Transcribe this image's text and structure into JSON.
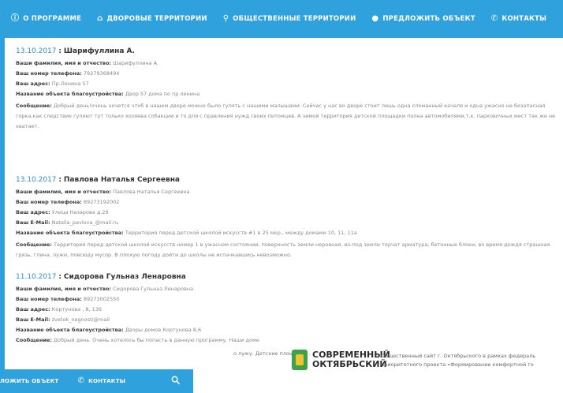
{
  "nav": {
    "items": [
      {
        "icon": "ⓘ",
        "label": "О ПРОГРАММЕ"
      },
      {
        "icon": "⌂",
        "label": "ДВОРОВЫЕ ТЕРРИТОРИИ"
      },
      {
        "icon": "⚲",
        "label": "ОБЩЕСТВЕННЫЕ ТЕРРИТОРИИ"
      },
      {
        "icon": "●",
        "label": "ПРЕДЛОЖИТЬ ОБЪЕКТ"
      },
      {
        "icon": "✆",
        "label": "КОНТАКТЫ"
      }
    ]
  },
  "entries": [
    {
      "date": "13.10.2017",
      "sep": ":",
      "name": "Шарифуллина А.",
      "fields": [
        {
          "label": "Ваши фамилия, имя и отчество:",
          "value": "Шарифуллина А."
        },
        {
          "label": "Ваш номер телефона:",
          "value": "79279368494"
        },
        {
          "label": "Ваш адрес:",
          "value": "Пр.Ленина 57"
        },
        {
          "label": "Название объекта благоустройства:",
          "value": "Двор 57 дома по пр ленина"
        },
        {
          "label": "Сообщение:",
          "value": "Добрый день!очень хочется чтоб в нашем дворе можно было гулять с нашими малышами. Сейчас у нас во дворе стоит лишь одна сломанный качеля и одна ужасно не безопасная горка,как следствие гуляют тут только хозяева собакции и то для с правления нужд своих питомцев. А зимой территория детской площадки полна автомобилями,т.к. парковочных мест так же не хватает."
        }
      ]
    },
    {
      "date": "13.10.2017",
      "sep": ":",
      "name": "Павлова Наталья Сергеевна",
      "fields": [
        {
          "label": "Ваши фамилия, имя и отчество:",
          "value": "Павлова Наталья Сергеевна"
        },
        {
          "label": "Ваш номер телефона:",
          "value": "89273192002"
        },
        {
          "label": "Ваш адрес:",
          "value": "Улица Назарова д.29"
        },
        {
          "label": "Ваш E-Mail:",
          "value": "Natalia_pavlova_@mail.ru"
        },
        {
          "label": "Название объекта благоустройства:",
          "value": "Территория перед детской школой искусств #1 в 25 мкр., между домами 10, 11, 11а"
        },
        {
          "label": "Сообщение:",
          "value": "Территория перед детской школой искусств номер 1 в ужасном состоянии, поверхность земли неровная, из-под земли торчат арматура, бетонные блоки, во время дождя страшная грязь, глина, лужи, повсюду мусор. В плохую погоду дойти до школы не испачкавшись невозможно."
        }
      ]
    },
    {
      "date": "11.10.2017",
      "sep": ":",
      "name": "Сидорова Гульназ Ленаровна",
      "fields": [
        {
          "label": "Ваши фамилия, имя и отчество:",
          "value": "Сидорова Гульназ Ленаровна"
        },
        {
          "label": "Ваш номер телефона:",
          "value": "89273002550"
        },
        {
          "label": "Ваш адрес:",
          "value": "Кортунова , 8, 136"
        },
        {
          "label": "Ваш E-Mail:",
          "value": "zvetok_negnosti@mail"
        },
        {
          "label": "Название объекта благоустройства:",
          "value": "Дворы домов Кортунова 8,6"
        },
        {
          "label": "Сообщение:",
          "value": "Добрый день. Очень хотелось бы попасть в данную программу. Наши доме"
        }
      ]
    }
  ],
  "cutoff_text": "о лужу. Детские площадки .",
  "footer": {
    "nav": [
      {
        "label": "ЛОЖИТЬ ОБЪЕКТ"
      },
      {
        "icon": "✆",
        "label": "КОНТАКТЫ"
      }
    ],
    "search_icon": "search-icon",
    "logo_line1": "СОВРЕМЕННЫЙ",
    "logo_line2": "ОКТЯБРЬСКИЙ",
    "desc_line1": "Общественный сайт г. Октябрьского в рамках федераль",
    "desc_line2": "приоритетного проекта «Формирование комфортной го"
  },
  "colors": {
    "accent": "#2fa1dc",
    "date": "#2a8fd0",
    "logo_green": "#3aa34a",
    "logo_yellow": "#f2c230"
  }
}
